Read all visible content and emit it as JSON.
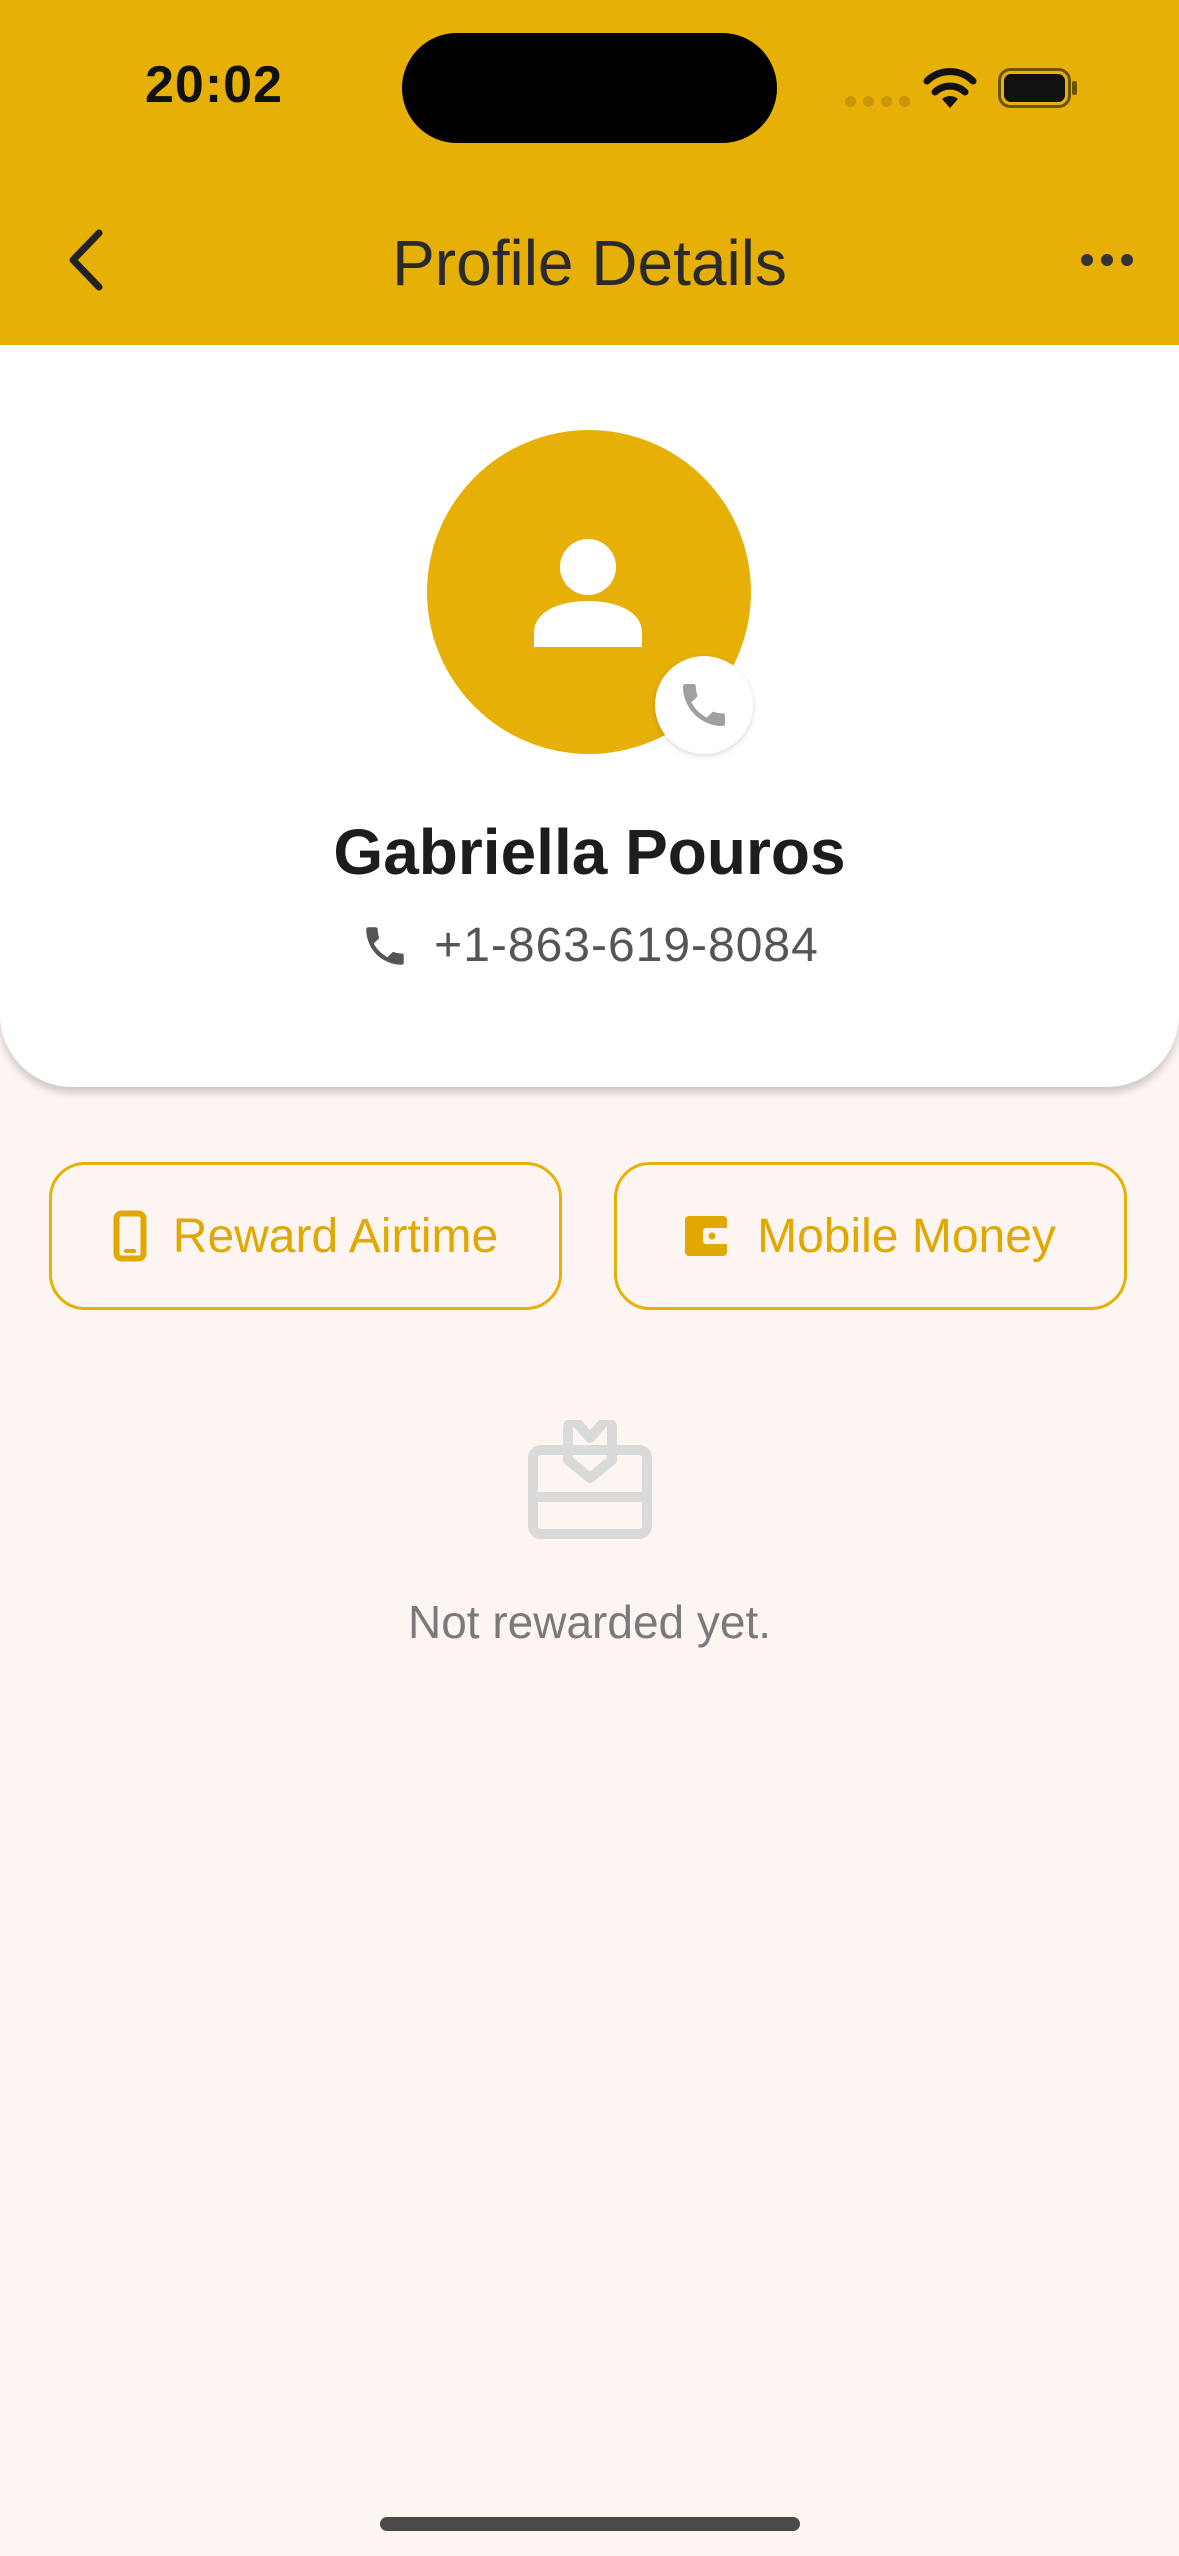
{
  "status_bar": {
    "time": "20:02"
  },
  "nav": {
    "title": "Profile Details",
    "back_icon": "chevron-left-icon",
    "more_icon": "ellipsis-icon"
  },
  "profile": {
    "name": "Gabriella Pouros",
    "phone": "+1-863-619-8084",
    "avatar_icon": "person-icon",
    "badge_icon": "phone-icon"
  },
  "actions": {
    "airtime_label": "Reward Airtime",
    "airtime_icon": "mobile-phone-icon",
    "money_label": "Mobile Money",
    "money_icon": "wallet-icon"
  },
  "empty_state": {
    "icon": "gift-card-icon",
    "message": "Not rewarded yet."
  },
  "colors": {
    "accent": "#e6b007",
    "background": "#fdf5f1",
    "card": "#ffffff"
  }
}
